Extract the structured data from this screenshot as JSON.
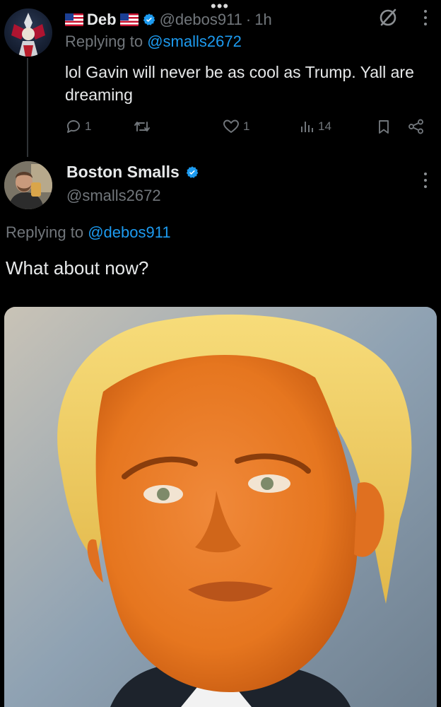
{
  "window": {
    "drag_handle_glyph": "•••"
  },
  "tweet1": {
    "display_name": "Deb",
    "handle": "@debos911",
    "separator": "·",
    "time": "1h",
    "replying_prefix": "Replying to",
    "replying_to": "@smalls2672",
    "text": "lol Gavin will never be as cool as Trump. Yall are dreaming",
    "replies": "1",
    "retweets": "",
    "likes": "1",
    "views": "14",
    "icons": [
      "us-flag-icon",
      "verified-badge-icon",
      "mute-icon",
      "more-vertical-icon",
      "reply-icon",
      "retweet-icon",
      "like-icon",
      "views-icon",
      "bookmark-icon",
      "share-icon"
    ]
  },
  "tweet2": {
    "display_name": "Boston Smalls",
    "handle": "@smalls2672",
    "replying_prefix": "Replying to",
    "replying_to": "@debos911",
    "text": "What about now?",
    "icons": [
      "verified-badge-icon",
      "more-vertical-icon"
    ]
  },
  "colors": {
    "background": "#000000",
    "primary_text": "#e7e9ea",
    "secondary_text": "#71767b",
    "link_blue": "#1d9bf0",
    "verified_blue": "#1d9bf0",
    "thread_line": "#2f3336"
  }
}
